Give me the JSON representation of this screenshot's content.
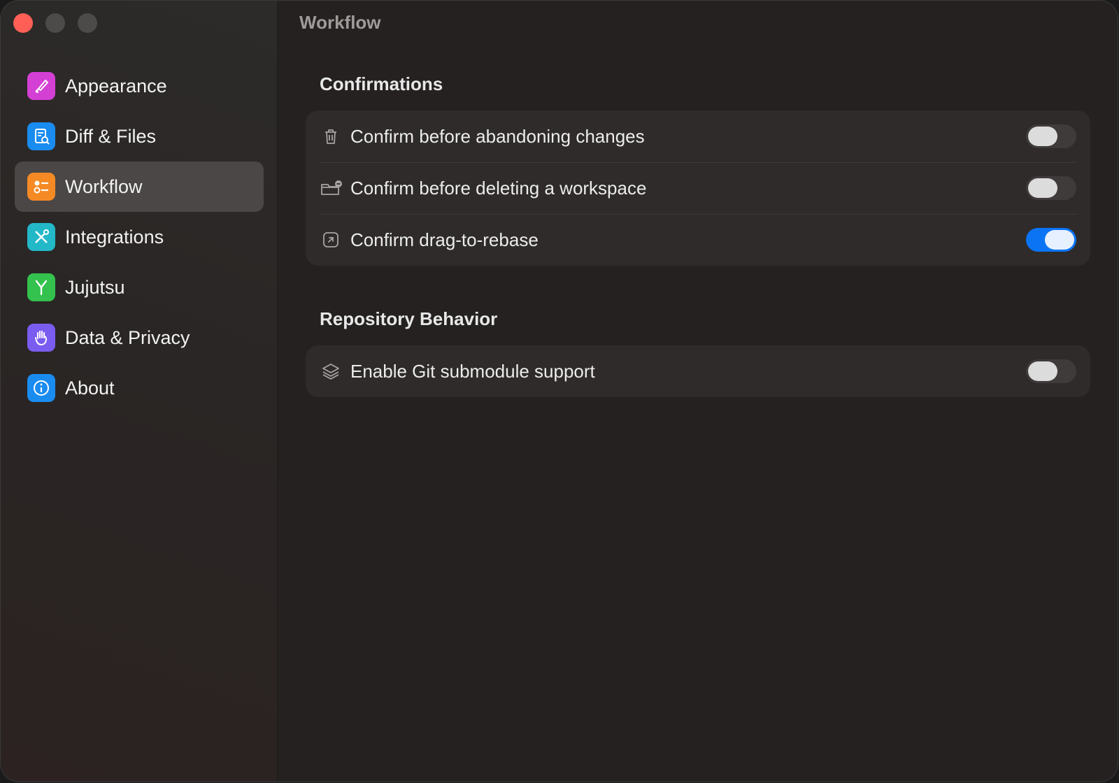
{
  "window": {
    "title": "Workflow"
  },
  "sidebar": {
    "items": [
      {
        "label": "Appearance",
        "icon": "paintbrush-icon",
        "color": "#d43fd4",
        "active": false
      },
      {
        "label": "Diff & Files",
        "icon": "document-search-icon",
        "color": "#1a8cf0",
        "active": false
      },
      {
        "label": "Workflow",
        "icon": "checklist-icon",
        "color": "#f58a25",
        "active": true
      },
      {
        "label": "Integrations",
        "icon": "wrench-screwdriver-icon",
        "color": "#23b8c8",
        "active": false
      },
      {
        "label": "Jujutsu",
        "icon": "branch-merge-icon",
        "color": "#33c24d",
        "active": false
      },
      {
        "label": "Data & Privacy",
        "icon": "hand-icon",
        "color": "#7b5cf0",
        "active": false
      },
      {
        "label": "About",
        "icon": "info-icon",
        "color": "#1a8cf0",
        "active": false
      }
    ]
  },
  "sections": {
    "confirmations": {
      "title": "Confirmations",
      "rows": [
        {
          "label": "Confirm before abandoning changes",
          "icon": "trash-icon",
          "enabled": false
        },
        {
          "label": "Confirm before deleting a workspace",
          "icon": "folder-minus-icon",
          "enabled": false
        },
        {
          "label": "Confirm drag-to-rebase",
          "icon": "arrow-up-right-square-icon",
          "enabled": true
        }
      ]
    },
    "repository": {
      "title": "Repository Behavior",
      "rows": [
        {
          "label": "Enable Git submodule support",
          "icon": "layers-icon",
          "enabled": false
        }
      ]
    }
  },
  "colors": {
    "accent": "#0a74f5",
    "close_light": "#ff5f57"
  }
}
